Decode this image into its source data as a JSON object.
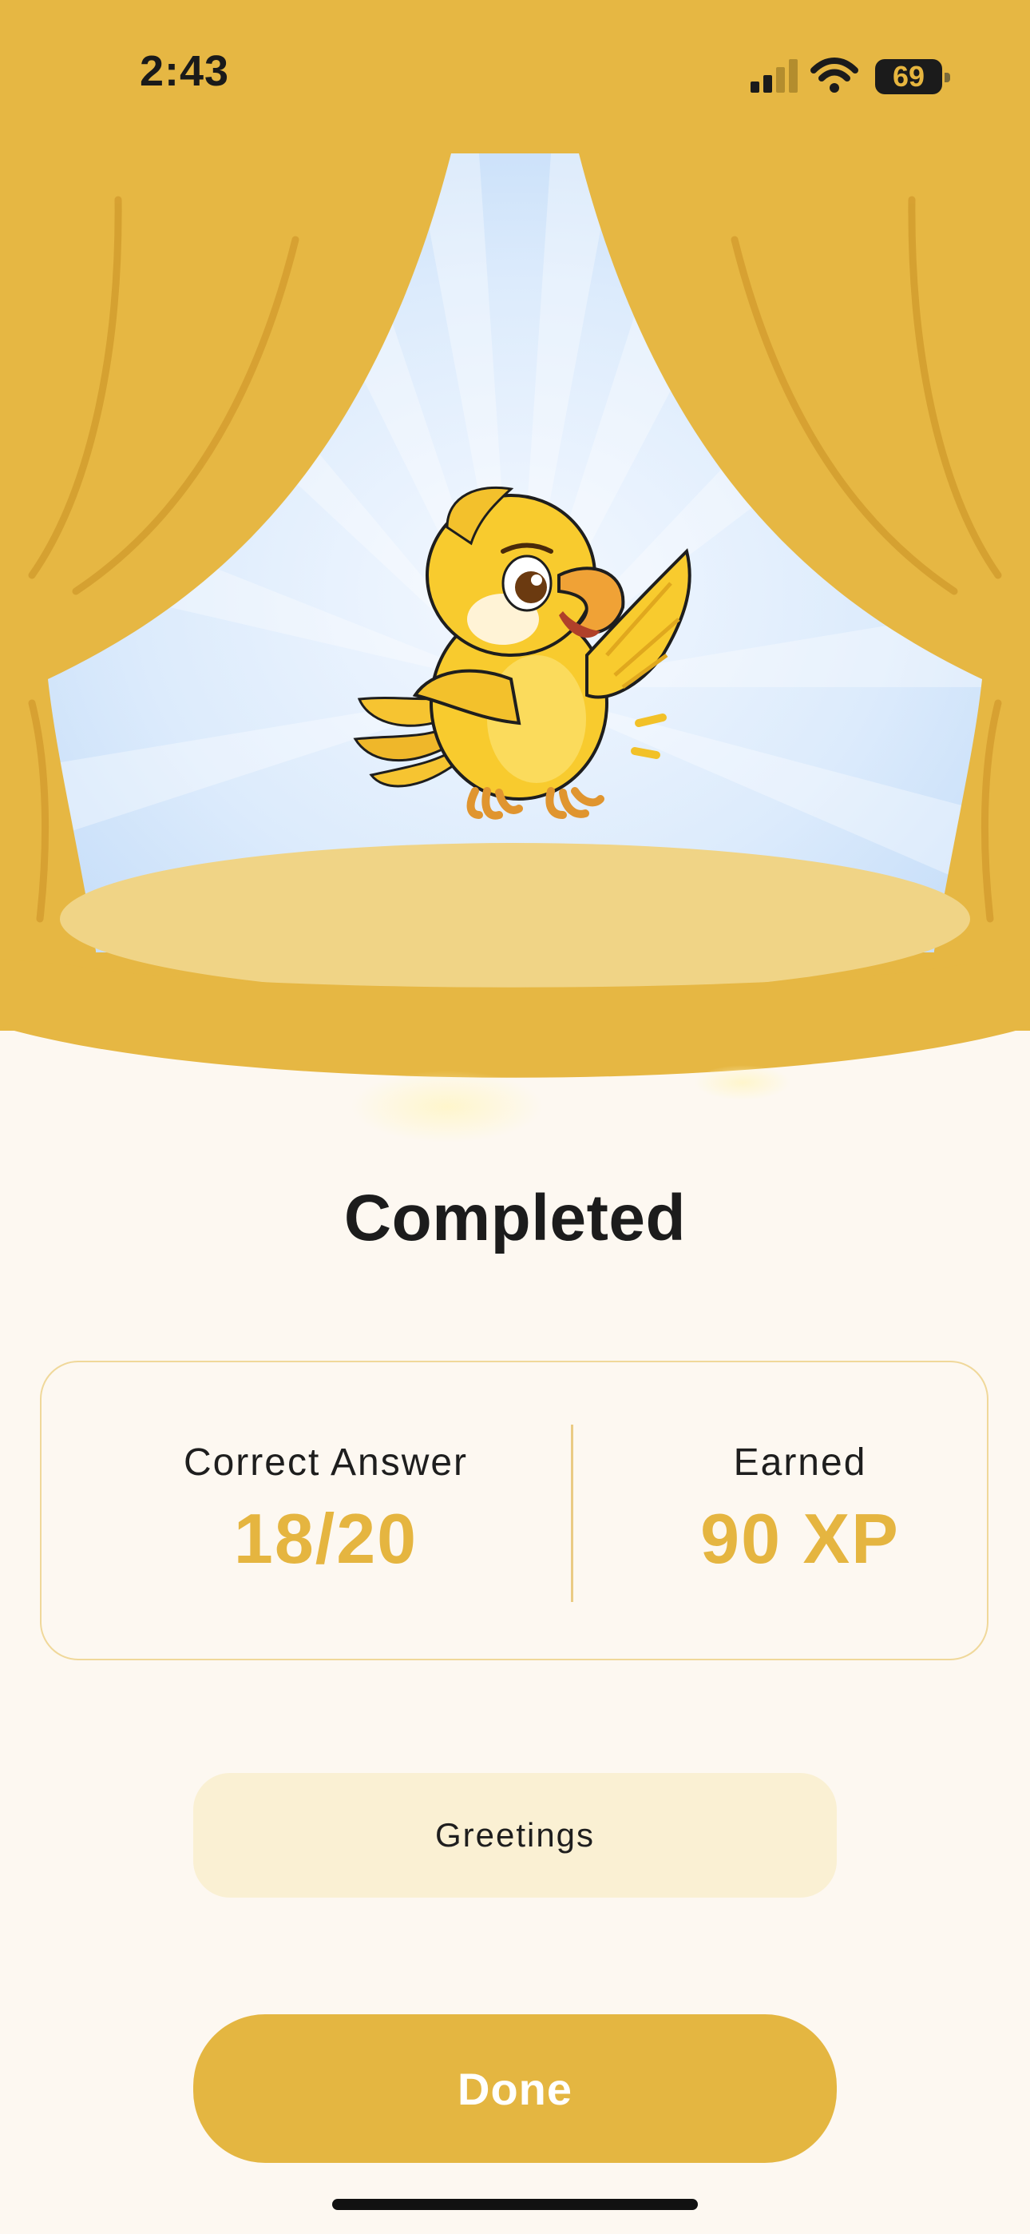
{
  "status_bar": {
    "time": "2:43",
    "battery": "69",
    "icons": [
      "cellular-signal-icon",
      "wifi-icon",
      "battery-icon"
    ]
  },
  "hero": {
    "mascot": "parrot-mascot-illustration",
    "scene": "stage-curtains"
  },
  "result": {
    "title": "Completed",
    "correct_label": "Correct Answer",
    "correct_value": "18/20",
    "earned_label": "Earned",
    "earned_value": "90 XP"
  },
  "topic": {
    "label": "Greetings"
  },
  "actions": {
    "done_label": "Done"
  },
  "colors": {
    "accent": "#E5B540",
    "curtain": "#E6B743",
    "sky": "#C8E0FA",
    "background": "#FDF8F1",
    "chip": "#FAF0D3"
  }
}
